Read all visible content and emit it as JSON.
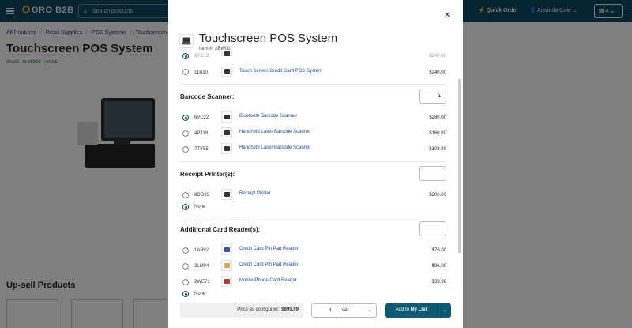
{
  "header": {
    "logo": "ORO B2B",
    "search_placeholder": "Search products",
    "quick_order": "Quick Order",
    "user_name": "Amanda Cole",
    "cart_count": "4"
  },
  "breadcrumb": [
    "All Products",
    "Retail Supplies",
    "POS Systems",
    "Touchscreen P"
  ],
  "page": {
    "title": "Touchscreen POS System",
    "sku": "2EW02",
    "stock": "IN STOCK",
    "brand": "ACME",
    "upsell_title": "Up-sell Products"
  },
  "modal": {
    "title": "Touchscreen POS System",
    "item_number": "Item #: 2EW02",
    "partial_row": {
      "sku": "6YC12",
      "price": "$240.00"
    },
    "top_row": {
      "sku": "11B10",
      "name": "Touch Screen Credit Card POS System",
      "price": "$240.00"
    },
    "groups": [
      {
        "label": "Barcode Scanner:",
        "qty": "1",
        "items": [
          {
            "sku": "6VC22",
            "name": "Bluetooth Barcode Scanner",
            "price": "$280.00"
          },
          {
            "sku": "4PJ19",
            "name": "Handheld Laser Barcode Scanner",
            "price": "$160.00"
          },
          {
            "sku": "7TY55",
            "name": "Handheld Laser Barcode Scanner",
            "price": "$103.99"
          }
        ]
      },
      {
        "label": "Receipt Printer(s):",
        "qty": "",
        "items": [
          {
            "sku": "8DO33",
            "name": "Receipt Printer",
            "price": "$200.00"
          }
        ],
        "none_label": "None"
      },
      {
        "label": "Additional Card Reader(s):",
        "qty": "",
        "items": [
          {
            "sku": "1AB92",
            "name": "Credit Card Pin Pad Reader",
            "price": "$76.00"
          },
          {
            "sku": "2LM04",
            "name": "Credit Card Pin Pad Reader",
            "price": "$96.00"
          },
          {
            "sku": "2WE71",
            "name": "Mobile Phone Card Reader",
            "price": "$39.96"
          }
        ],
        "none_label": "None"
      }
    ],
    "price_configured_label": "Price as configured:",
    "price_configured_value": "$895.99",
    "qty": "1",
    "unit": "set",
    "add_button_prefix": "Add to",
    "add_button_target": "My List"
  },
  "colors": {
    "brand": "#0d4b63",
    "link": "#1a4a9a",
    "button": "#0d5a72"
  }
}
